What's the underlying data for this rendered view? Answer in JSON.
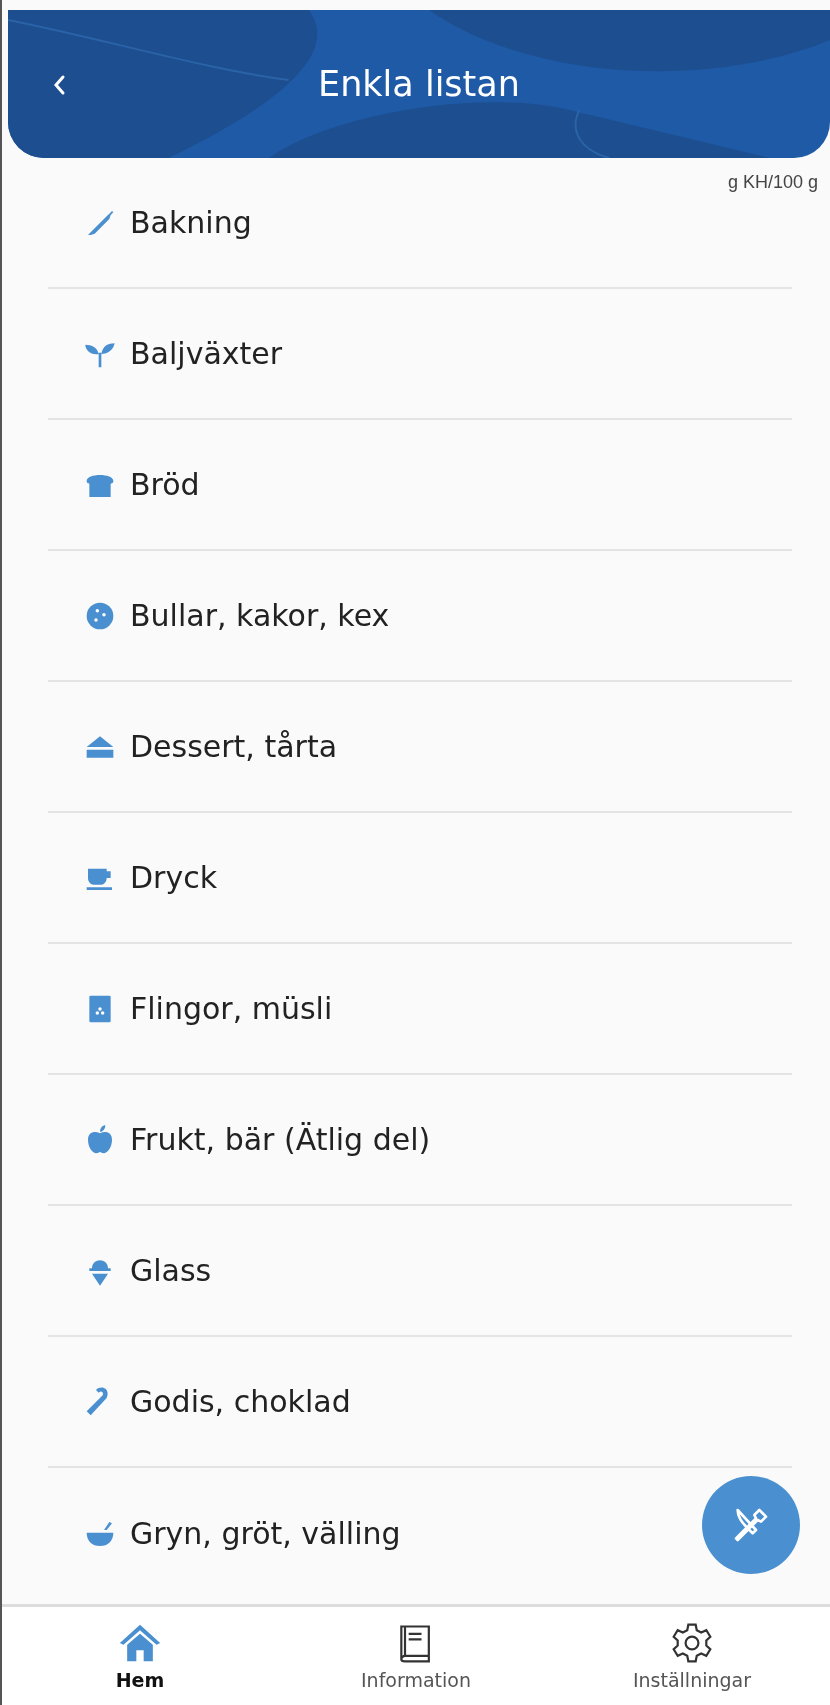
{
  "header": {
    "title": "Enkla listan"
  },
  "unit_label": "g KH/100 g",
  "categories": [
    {
      "label": "Bakning"
    },
    {
      "label": "Baljväxter"
    },
    {
      "label": "Bröd"
    },
    {
      "label": "Bullar, kakor, kex"
    },
    {
      "label": "Dessert, tårta"
    },
    {
      "label": "Dryck"
    },
    {
      "label": "Flingor, müsli"
    },
    {
      "label": "Frukt, bär (Ätlig del)"
    },
    {
      "label": "Glass"
    },
    {
      "label": "Godis, choklad"
    },
    {
      "label": "Gryn, gröt, välling"
    }
  ],
  "bottom_nav": [
    {
      "label": "Hem",
      "selected": true
    },
    {
      "label": "Information",
      "selected": false
    },
    {
      "label": "Inställningar",
      "selected": false
    }
  ]
}
